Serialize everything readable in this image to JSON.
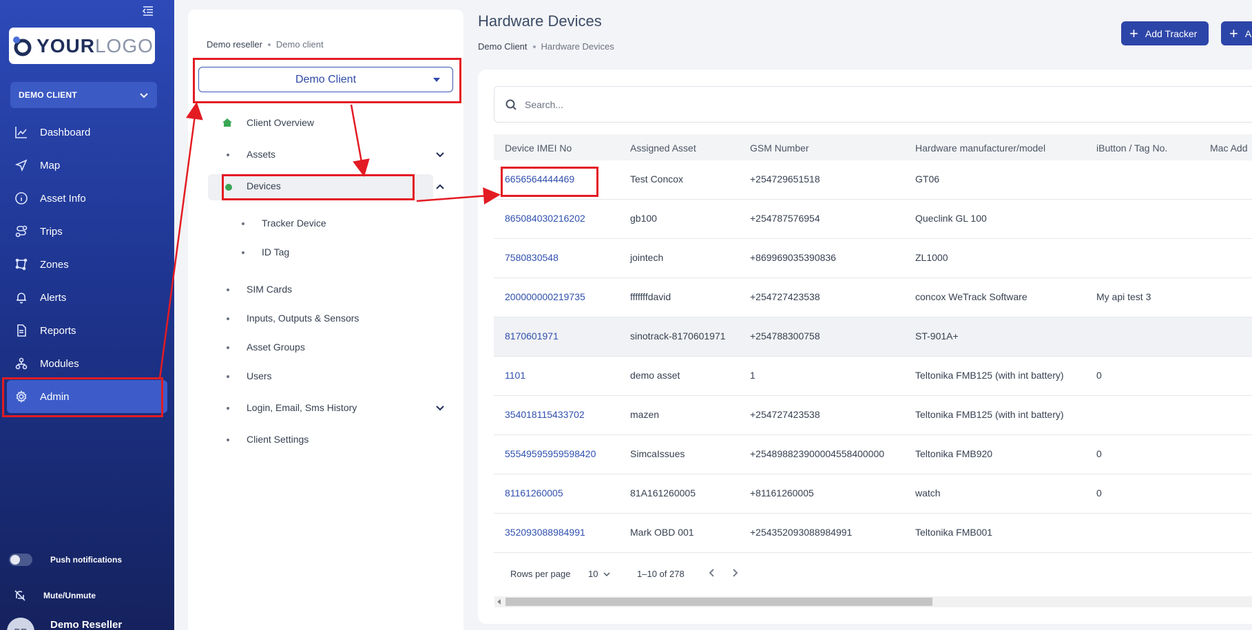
{
  "sidebar": {
    "logo": {
      "brand_bold": "YOUR",
      "brand_light": "LOGO"
    },
    "client_selector": {
      "label": "DEMO CLIENT"
    },
    "nav": [
      {
        "label": "Dashboard",
        "icon": "chart-line-icon"
      },
      {
        "label": "Map",
        "icon": "navigation-arrow-icon"
      },
      {
        "label": "Asset Info",
        "icon": "info-circle-icon"
      },
      {
        "label": "Trips",
        "icon": "route-icon"
      },
      {
        "label": "Zones",
        "icon": "polygon-icon"
      },
      {
        "label": "Alerts",
        "icon": "bell-icon"
      },
      {
        "label": "Reports",
        "icon": "document-icon"
      },
      {
        "label": "Modules",
        "icon": "modules-icon"
      },
      {
        "label": "Admin",
        "icon": "gear-icon",
        "active": true
      }
    ],
    "push_notifications_label": "Push notifications",
    "mute_label": "Mute/Unmute",
    "user": {
      "initials": "DR",
      "name": "Demo Reseller"
    }
  },
  "admin_panel": {
    "breadcrumb": {
      "parent": "Demo reseller",
      "current": "Demo client"
    },
    "client_dropdown_value": "Demo Client",
    "menu": {
      "client_overview": "Client Overview",
      "assets": "Assets",
      "devices": "Devices",
      "tracker_device": "Tracker Device",
      "id_tag": "ID Tag",
      "sim_cards": "SIM Cards",
      "inputs_outputs": "Inputs, Outputs & Sensors",
      "asset_groups": "Asset Groups",
      "users": "Users",
      "login_history": "Login, Email, Sms History",
      "client_settings": "Client Settings"
    }
  },
  "main": {
    "title": "Hardware Devices",
    "breadcrumb": {
      "parent": "Demo Client",
      "current": "Hardware Devices"
    },
    "buttons": {
      "add_tracker": "Add Tracker",
      "second": "A"
    },
    "search_placeholder": "Search...",
    "columns": [
      "Device IMEI No",
      "Assigned Asset",
      "GSM Number",
      "Hardware manufacturer/model",
      "iButton / Tag No.",
      "Mac Add"
    ],
    "rows": [
      [
        "6656564444469",
        "Test Concox",
        "+254729651518",
        "GT06",
        ""
      ],
      [
        "865084030216202",
        "gb100",
        "+254787576954",
        "Queclink GL 100",
        ""
      ],
      [
        "7580830548",
        "jointech",
        "+869969035390836",
        "ZL1000",
        ""
      ],
      [
        "200000000219735",
        "fffffffdavid",
        "+254727423538",
        "concox WeTrack Software",
        "My api test 3"
      ],
      [
        "8170601971",
        "sinotrack-8170601971",
        "+254788300758",
        "ST-901A+",
        ""
      ],
      [
        "1101",
        "demo asset",
        "1",
        "Teltonika FMB125 (with int battery)",
        "0"
      ],
      [
        "354018115433702",
        "mazen",
        "+254727423538",
        "Teltonika FMB125 (with int battery)",
        ""
      ],
      [
        "55549595959598420",
        "SimcaIssues",
        "+254898823900004558400000",
        "Teltonika FMB920",
        "0"
      ],
      [
        "81161260005",
        "81A161260005",
        "+81161260005",
        "watch",
        "0"
      ],
      [
        "352093088984991",
        "Mark OBD 001",
        "+254352093088984991",
        "Teltonika FMB001",
        ""
      ]
    ],
    "pagination": {
      "rows_per_page_label": "Rows per page",
      "rows_per_page_value": "10",
      "range": "1–10 of 278"
    }
  },
  "colors": {
    "sidebar": "#1e3590",
    "accent": "#2c45a8",
    "annotation": "#e31b23",
    "active_dot": "#3aa655"
  }
}
